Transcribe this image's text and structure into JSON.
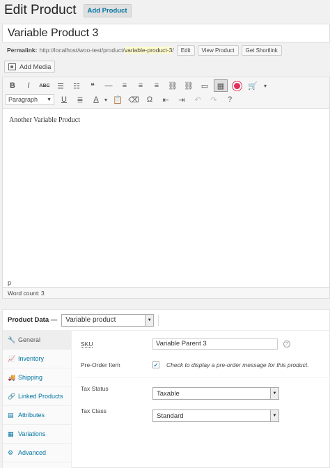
{
  "header": {
    "title": "Edit Product",
    "add_new": "Add Product"
  },
  "post": {
    "title": "Variable Product 3",
    "permalink_label": "Permalink:",
    "permalink_base": "http://localhost/woo-test/product/",
    "permalink_slug": "variable-product-3",
    "permalink_trail": "/",
    "edit_label": "Edit",
    "view_label": "View Product",
    "shortlink_label": "Get Shortlink"
  },
  "editor": {
    "add_media_label": "Add Media",
    "format_select": "Paragraph",
    "content": "Another Variable Product",
    "path": "p",
    "word_count": "Word count: 3",
    "toolbar_row1": [
      {
        "name": "bold-icon",
        "glyph": "B"
      },
      {
        "name": "italic-icon",
        "glyph": "I"
      },
      {
        "name": "strikethrough-icon",
        "glyph": "ABC"
      },
      {
        "name": "bullet-list-icon",
        "glyph": "☰"
      },
      {
        "name": "numbered-list-icon",
        "glyph": "☷"
      },
      {
        "name": "blockquote-icon",
        "glyph": "❝"
      },
      {
        "name": "horizontal-rule-icon",
        "glyph": "—"
      },
      {
        "name": "align-left-icon",
        "glyph": "≡"
      },
      {
        "name": "align-center-icon",
        "glyph": "≡"
      },
      {
        "name": "align-right-icon",
        "glyph": "≡"
      },
      {
        "name": "link-icon",
        "glyph": "⛓"
      },
      {
        "name": "unlink-icon",
        "glyph": "⛓"
      },
      {
        "name": "read-more-icon",
        "glyph": "▭"
      },
      {
        "name": "toolbar-toggle-icon",
        "glyph": "▦"
      },
      {
        "name": "target-icon",
        "glyph": ""
      },
      {
        "name": "cart-icon",
        "glyph": "🛒"
      },
      {
        "name": "dropdown-arrow-icon",
        "glyph": "▾"
      }
    ],
    "toolbar_row2": [
      {
        "name": "underline-icon",
        "glyph": "U"
      },
      {
        "name": "justify-icon",
        "glyph": "≣"
      },
      {
        "name": "text-color-icon",
        "glyph": "A"
      },
      {
        "name": "text-color-arrow-icon",
        "glyph": "▾"
      },
      {
        "name": "paste-text-icon",
        "glyph": "📋"
      },
      {
        "name": "clear-formatting-icon",
        "glyph": "⌫"
      },
      {
        "name": "special-character-icon",
        "glyph": "Ω"
      },
      {
        "name": "outdent-icon",
        "glyph": "⇤"
      },
      {
        "name": "indent-icon",
        "glyph": "⇥"
      },
      {
        "name": "undo-icon",
        "glyph": "↶"
      },
      {
        "name": "redo-icon",
        "glyph": "↷"
      },
      {
        "name": "help-icon",
        "glyph": "?"
      }
    ]
  },
  "product_data": {
    "label": "Product Data —",
    "type": "Variable product",
    "tabs": [
      {
        "label": "General",
        "icon": "wrench-icon",
        "glyph": "🔧"
      },
      {
        "label": "Inventory",
        "icon": "chart-icon",
        "glyph": "📈"
      },
      {
        "label": "Shipping",
        "icon": "truck-icon",
        "glyph": "🚚"
      },
      {
        "label": "Linked Products",
        "icon": "link-icon",
        "glyph": "🔗"
      },
      {
        "label": "Attributes",
        "icon": "list-icon",
        "glyph": "▤"
      },
      {
        "label": "Variations",
        "icon": "grid-icon",
        "glyph": "▦"
      },
      {
        "label": "Advanced",
        "icon": "gear-icon",
        "glyph": "⚙"
      }
    ],
    "sku_label": "SKU",
    "sku_value": "Variable Parent 3",
    "preorder_label": "Pre-Order Item",
    "preorder_desc": "Check to display a pre-order message for this product.",
    "tax_status_label": "Tax Status",
    "tax_status_value": "Taxable",
    "tax_class_label": "Tax Class",
    "tax_class_value": "Standard"
  }
}
